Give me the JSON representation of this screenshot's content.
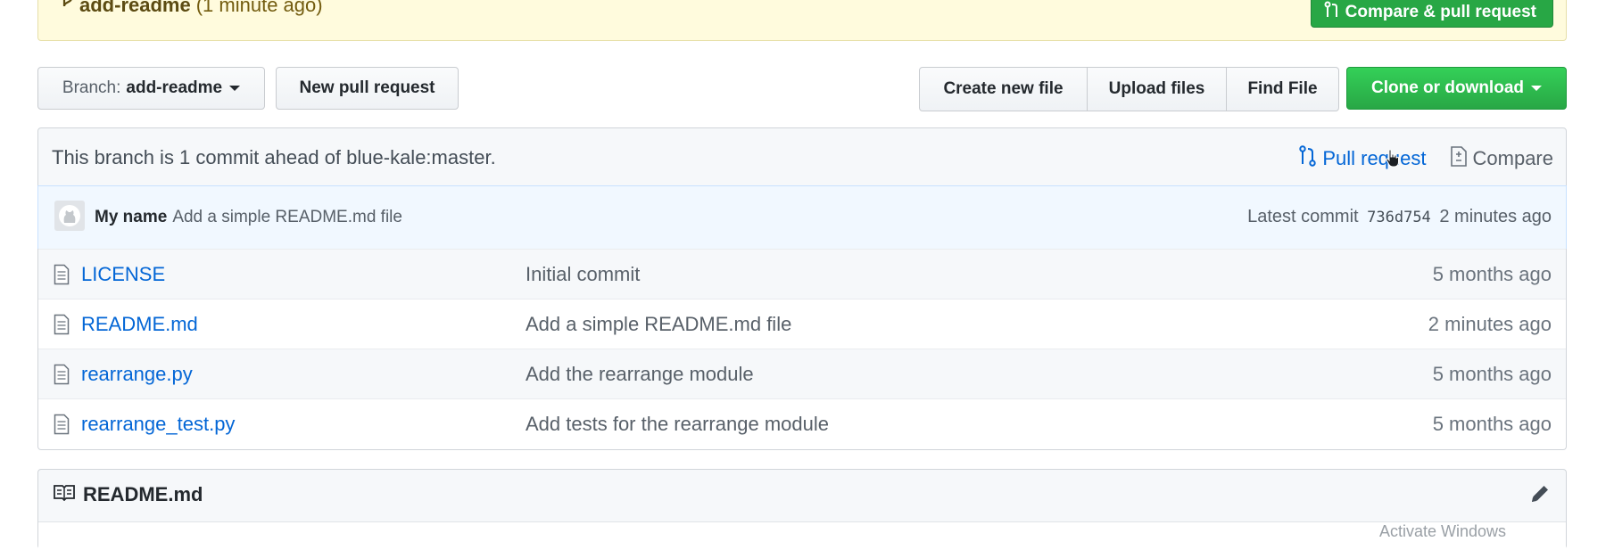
{
  "banner": {
    "branch": "add-readme",
    "time": "(1 minute ago)",
    "compare_button": "Compare & pull request"
  },
  "toolbar": {
    "branch_prefix": "Branch:",
    "branch_name": "add-readme",
    "new_pull_request": "New pull request",
    "create_new_file": "Create new file",
    "upload_files": "Upload files",
    "find_file": "Find File",
    "clone_or_download": "Clone or download"
  },
  "branch_info": {
    "text": "This branch is 1 commit ahead of blue-kale:master.",
    "pull_request": "Pull request",
    "compare": "Compare"
  },
  "latest_commit": {
    "author": "My name",
    "message": "Add a simple README.md file",
    "label": "Latest commit",
    "sha": "736d754",
    "time": "2 minutes ago"
  },
  "files": [
    {
      "name": "LICENSE",
      "message": "Initial commit",
      "age": "5 months ago"
    },
    {
      "name": "README.md",
      "message": "Add a simple README.md file",
      "age": "2 minutes ago"
    },
    {
      "name": "rearrange.py",
      "message": "Add the rearrange module",
      "age": "5 months ago"
    },
    {
      "name": "rearrange_test.py",
      "message": "Add tests for the rearrange module",
      "age": "5 months ago"
    }
  ],
  "readme": {
    "title": "README.md"
  },
  "watermark": "Activate Windows",
  "colors": {
    "link": "#0366d6",
    "primary_green": "#28a745",
    "banner_bg": "#fffbdd",
    "commit_bar_bg": "#f1f8ff"
  }
}
